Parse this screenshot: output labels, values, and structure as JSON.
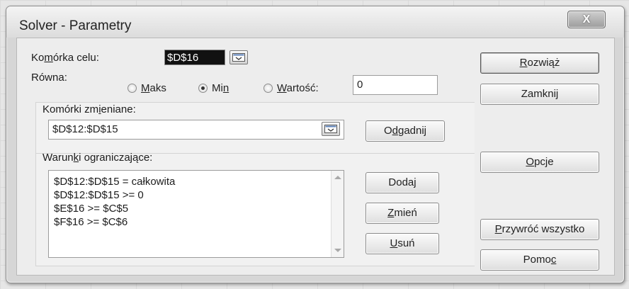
{
  "window": {
    "title": "Solver - Parametry",
    "close_label": "X"
  },
  "target": {
    "label_before": "Ko",
    "label_accel": "m",
    "label_after": "órka celu:",
    "value": "$D$16"
  },
  "equal": {
    "label": "Równa:",
    "options": [
      {
        "before": "",
        "accel": "M",
        "after": "aks",
        "selected": false
      },
      {
        "before": "Mi",
        "accel": "n",
        "after": "",
        "selected": true
      },
      {
        "before": "",
        "accel": "W",
        "after": "artość:",
        "selected": false
      }
    ],
    "value_field": "0"
  },
  "changing": {
    "label_before": "Komórki zm",
    "label_accel": "i",
    "label_after": "eniane:",
    "value": "$D$12:$D$15",
    "guess_before": "O",
    "guess_accel": "d",
    "guess_after": "gadnij"
  },
  "constraints": {
    "label_before": "Warun",
    "label_accel": "k",
    "label_after": "i ograniczające:",
    "items": [
      "$D$12:$D$15 = całkowita",
      "$D$12:$D$15 >= 0",
      "$E$16 >= $C$5",
      "$F$16 >= $C$6"
    ],
    "add": {
      "before": "Doda",
      "accel": "j",
      "after": ""
    },
    "change": {
      "before": "",
      "accel": "Z",
      "after": "mień"
    },
    "delete": {
      "before": "",
      "accel": "U",
      "after": "suń"
    }
  },
  "actions": {
    "solve": {
      "before": "",
      "accel": "R",
      "after": "ozwiąż"
    },
    "close": {
      "before": "Zamknij",
      "accel": "",
      "after": ""
    },
    "options": {
      "before": "",
      "accel": "O",
      "after": "pcje"
    },
    "reset": {
      "before": "",
      "accel": "P",
      "after": "rzywróć wszystko"
    },
    "help": {
      "before": "Pomo",
      "accel": "c",
      "after": ""
    }
  }
}
